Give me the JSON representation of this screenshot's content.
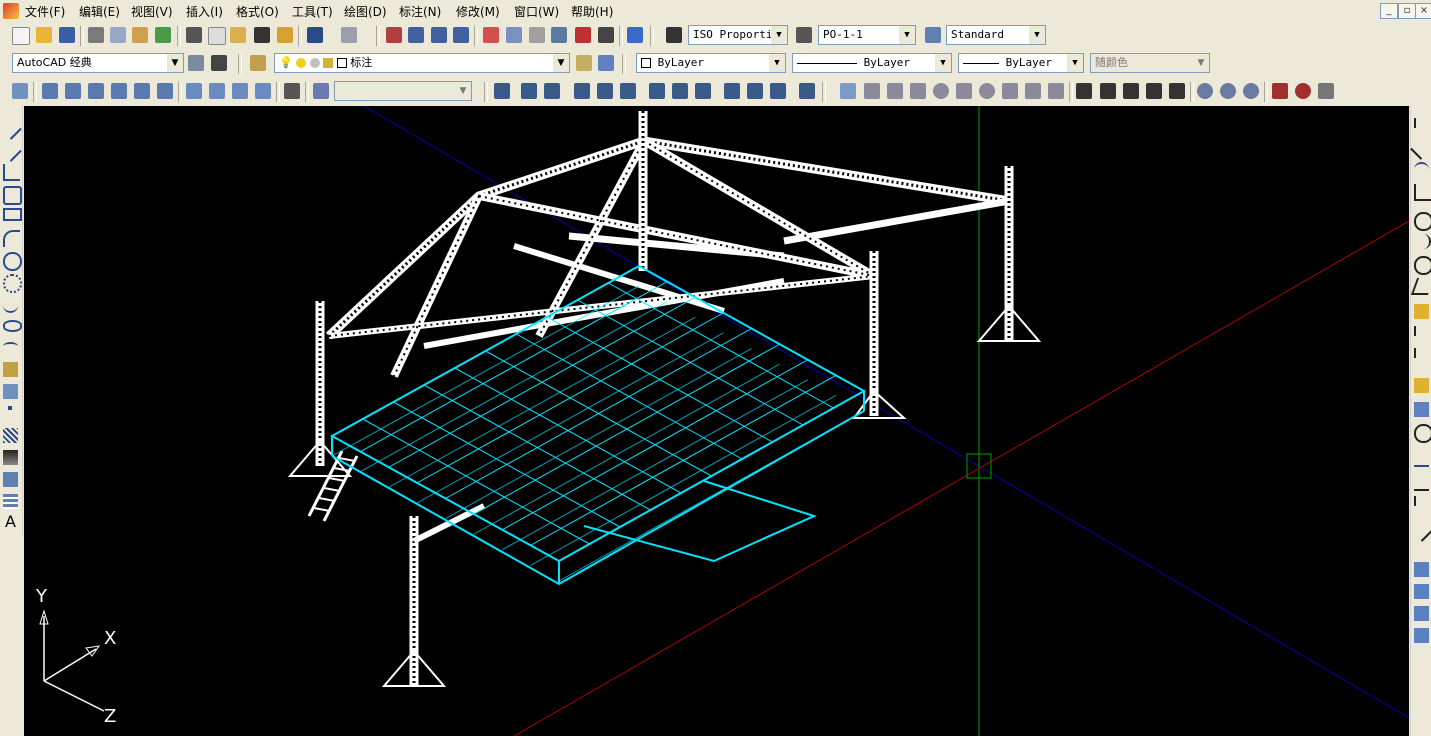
{
  "menubar": {
    "items": [
      "文件(F)",
      "编辑(E)",
      "视图(V)",
      "插入(I)",
      "格式(O)",
      "工具(T)",
      "绘图(D)",
      "标注(N)",
      "修改(M)",
      "窗口(W)",
      "帮助(H)"
    ],
    "window_controls": [
      "_",
      "▫",
      "×"
    ]
  },
  "toolbar1": {
    "text_style": "ISO Proportic",
    "dim_style": "PO-1-1",
    "table_style": "Standard"
  },
  "toolbar2": {
    "workspace": "AutoCAD 经典",
    "layer": "标注",
    "color": "ByLayer",
    "linetype": "ByLayer",
    "lineweight": "ByLayer",
    "plotstyle": "随颜色"
  },
  "toolbar3": {
    "view_combo": ""
  },
  "ucs": {
    "x": "X",
    "y": "Y",
    "z": "Z"
  },
  "colors": {
    "canvas": "#000000",
    "truss": "#ffffff",
    "deck": "#00e5ff",
    "x_axis_line": "#b00000",
    "y_axis_line": "#00a000",
    "z_axis_line": "#0000b0",
    "supports": "#6a3cff"
  },
  "icons": {
    "left": [
      "line-icon",
      "construction-line-icon",
      "polyline-icon",
      "polygon-icon",
      "rectangle-icon",
      "arc-icon",
      "circle-icon",
      "revision-cloud-icon",
      "spline-icon",
      "ellipse-icon",
      "ellipse-arc-icon",
      "insert-block-icon",
      "make-block-icon",
      "point-icon",
      "hatch-icon",
      "gradient-icon",
      "region-icon",
      "table-icon",
      "multiline-text-icon"
    ],
    "right": [
      "linear-dim-icon",
      "aligned-dim-icon",
      "arc-length-dim-icon",
      "ordinate-dim-icon",
      "radius-dim-icon",
      "jogged-dim-icon",
      "diameter-dim-icon",
      "angular-dim-icon",
      "quick-dim-icon",
      "baseline-dim-icon",
      "continue-dim-icon",
      "quick-leader-icon",
      "tolerance-icon",
      "center-mark-icon",
      "dim-edit-icon",
      "dim-text-edit-icon",
      "dim-update-icon",
      "dim-style-icon",
      "layers-1-icon",
      "layers-2-icon",
      "layers-3-icon",
      "layers-4-icon"
    ]
  }
}
